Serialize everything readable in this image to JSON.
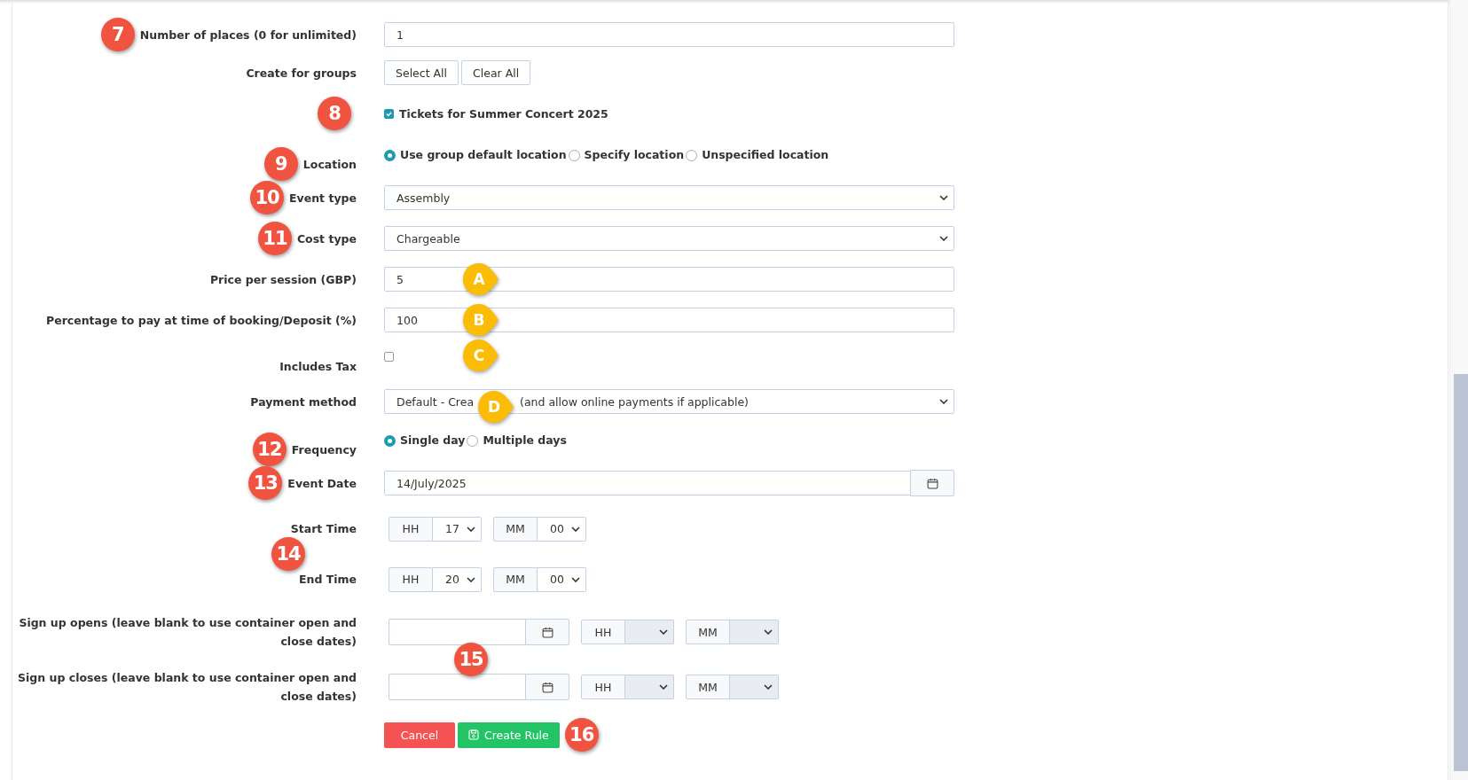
{
  "form": {
    "rows": [
      {
        "kind": "text",
        "label": "Number of places (0 for unlimited)",
        "value": "1",
        "marker": {
          "kind": "circle",
          "label": "7"
        }
      },
      {
        "kind": "buttons",
        "label": "Create for groups",
        "buttons": [
          "Select All",
          "Clear All"
        ]
      },
      {
        "kind": "checkbox",
        "label": "Tickets for Summer Concert 2025",
        "checked": true,
        "marker": {
          "kind": "circle",
          "label": "8"
        }
      },
      {
        "kind": "radio",
        "label": "Location",
        "options": [
          {
            "label": "Use group default location",
            "selected": true
          },
          {
            "label": "Specify location",
            "selected": false
          },
          {
            "label": "Unspecified location",
            "selected": false
          }
        ],
        "marker": {
          "kind": "circle",
          "label": "9"
        }
      },
      {
        "kind": "select",
        "label": "Event type",
        "value_parts": [
          "Assembly"
        ],
        "marker": {
          "kind": "circle",
          "label": "10"
        }
      },
      {
        "kind": "select",
        "label": "Cost type",
        "value_parts": [
          "Chargeable"
        ],
        "marker": {
          "kind": "circle",
          "label": "11"
        }
      },
      {
        "kind": "text",
        "label": "Price per session (GBP)",
        "value": "5",
        "marker": {
          "kind": "pin",
          "label": "A"
        }
      },
      {
        "kind": "text",
        "label": "Percentage to pay at time of booking/Deposit (%)",
        "value": "100",
        "marker": {
          "kind": "pin",
          "label": "B"
        }
      },
      {
        "kind": "tick",
        "label": "Includes Tax",
        "checked": false,
        "marker": {
          "kind": "pin",
          "label": "C"
        }
      },
      {
        "kind": "select",
        "label": "Payment method",
        "value_parts": [
          "Default - Crea",
          "(and allow online payments if applicable)"
        ],
        "marker": {
          "kind": "pin",
          "label": "D"
        }
      },
      {
        "kind": "radio",
        "label": "Frequency",
        "options": [
          {
            "label": "Single day",
            "selected": true
          },
          {
            "label": "Multiple days",
            "selected": false
          }
        ],
        "marker": {
          "kind": "circle",
          "label": "12"
        }
      },
      {
        "kind": "date",
        "label": "Event Date",
        "value": "14/July/2025",
        "marker": {
          "kind": "circle",
          "label": "13"
        }
      },
      {
        "kind": "times",
        "marker": {
          "kind": "circle",
          "label": "14"
        },
        "items": [
          {
            "label": "Start Time",
            "hour_addon": "HH",
            "hour": "17",
            "minute_addon": "MM",
            "minute": "00"
          },
          {
            "label": "End Time",
            "hour_addon": "HH",
            "hour": "20",
            "minute_addon": "MM",
            "minute": "00"
          }
        ]
      },
      {
        "kind": "signups",
        "marker": {
          "kind": "circle",
          "label": "15"
        },
        "items": [
          {
            "label": "Sign up opens (leave blank to use container open and close dates)",
            "hour_addon": "HH",
            "minute_addon": "MM"
          },
          {
            "label": "Sign up closes (leave blank to use container open and close dates)",
            "hour_addon": "HH",
            "minute_addon": "MM"
          }
        ]
      },
      {
        "kind": "actions",
        "cancel": "Cancel",
        "submit": "Create Rule",
        "marker": {
          "kind": "circle",
          "label": "16"
        }
      }
    ]
  }
}
